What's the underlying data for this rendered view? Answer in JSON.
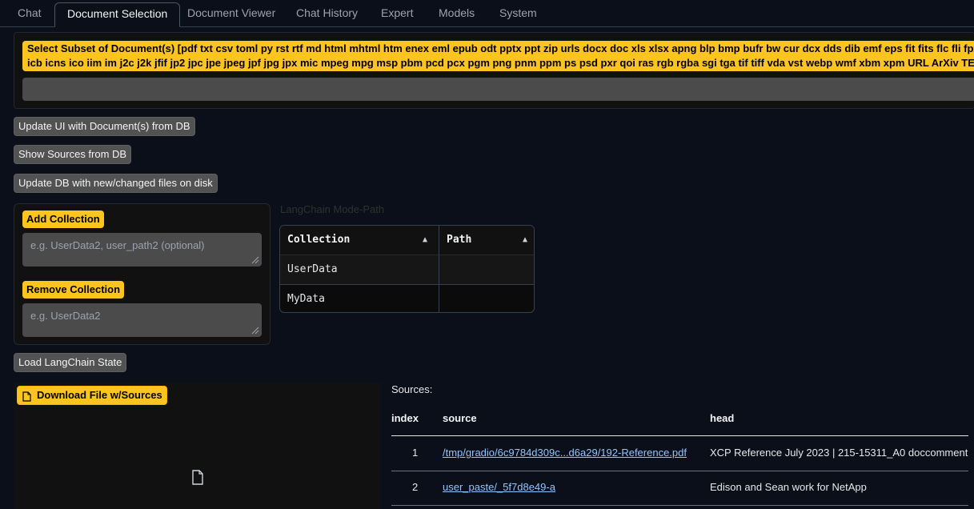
{
  "tabs": [
    {
      "label": "Chat",
      "active": false
    },
    {
      "label": "Document Selection",
      "active": true
    },
    {
      "label": "Document Viewer",
      "active": false
    },
    {
      "label": "Chat History",
      "active": false
    },
    {
      "label": "Expert",
      "active": false
    },
    {
      "label": "Models",
      "active": false
    },
    {
      "label": "System",
      "active": false
    }
  ],
  "doc_select": {
    "label_line1": "Select Subset of Document(s) [pdf txt csv toml py rst rtf md html mhtml htm enex eml epub odt pptx ppt zip urls docx doc xls xlsx apng blp bmp bufr bw cur dcx dds dib emf eps fit fits flc fli fpx",
    "label_line2": "icb icns ico iim im j2c j2k jfif jp2 jpc jpe jpeg jpf jpg jpx mic mpeg mpg msp pbm pcd pcx pgm png pnm ppm ps psd pxr qoi ras rgb rgba sgi tga tif tiff vda vst webp wmf xbm xpm URL ArXiv TEX"
  },
  "buttons": {
    "update_ui": "Update UI with Document(s) from DB",
    "show_sources": "Show Sources from DB",
    "update_db": "Update DB with new/changed files on disk",
    "load_state": "Load LangChain State"
  },
  "collections": {
    "add_label": "Add Collection",
    "add_placeholder": "e.g. UserData2, user_path2 (optional)",
    "remove_label": "Remove Collection",
    "remove_placeholder": "e.g. UserData2"
  },
  "mode_path": {
    "label": "LangChain Mode-Path",
    "headers": [
      "Collection",
      "Path"
    ],
    "sort_glyph": "▲",
    "rows": [
      [
        "UserData",
        ""
      ],
      [
        "MyData",
        ""
      ]
    ]
  },
  "download": {
    "label": "Download File w/Sources"
  },
  "sources": {
    "title": "Sources:",
    "headers": [
      "index",
      "source",
      "head"
    ],
    "rows": [
      {
        "index": "1",
        "source": "/tmp/gradio/6c9784d309c...d6a29/192-Reference.pdf",
        "head": "XCP Reference July 2023 | 215-15311_A0 doccomment"
      },
      {
        "index": "2",
        "source": "user_paste/_5f7d8e49-a",
        "head": "Edison and Sean work for NetApp"
      }
    ]
  },
  "colors": {
    "accent_yellow": "#fcc41e",
    "background": "#0b0f19",
    "panel": "#111111",
    "button_gray": "#525252",
    "link_blue": "#93c5fd"
  }
}
